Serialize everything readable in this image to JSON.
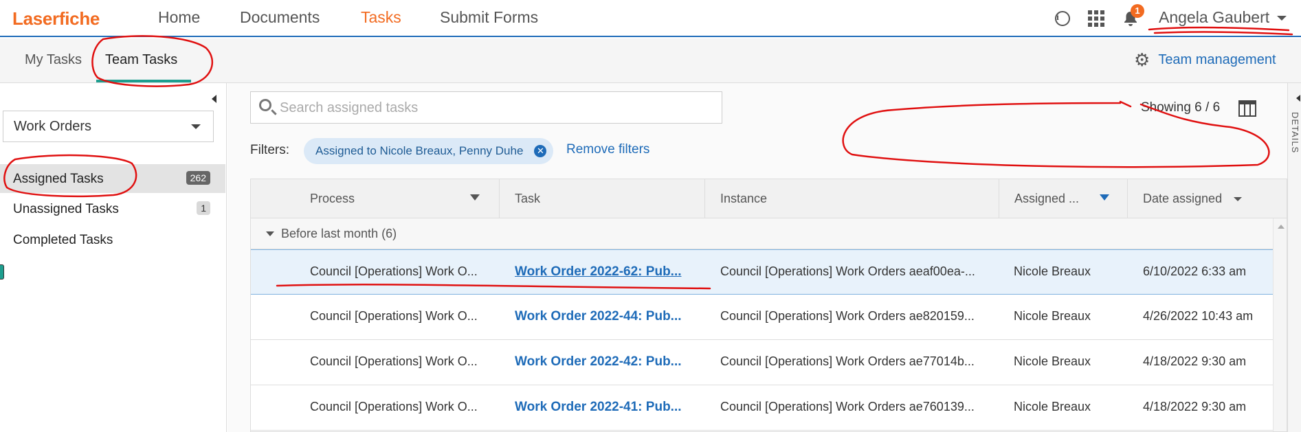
{
  "app": {
    "logo": "Laserfiche"
  },
  "nav": {
    "items": [
      {
        "label": "Home"
      },
      {
        "label": "Documents"
      },
      {
        "label": "Tasks"
      },
      {
        "label": "Submit Forms"
      }
    ],
    "active": "Tasks",
    "notification_count": "1",
    "user_name": "Angela Gaubert"
  },
  "subtabs": {
    "items": [
      {
        "label": "My Tasks"
      },
      {
        "label": "Team Tasks"
      }
    ],
    "active": "Team Tasks",
    "team_management": "Team management"
  },
  "sidebar": {
    "team_select": "Work Orders",
    "items": [
      {
        "label": "Assigned Tasks",
        "count": "262"
      },
      {
        "label": "Unassigned Tasks",
        "count": "1"
      },
      {
        "label": "Completed Tasks"
      }
    ]
  },
  "main": {
    "search_placeholder": "Search assigned tasks",
    "showing": "Showing 6 / 6",
    "filters_label": "Filters:",
    "filter_chip": "Assigned to Nicole Breaux, Penny Duhe",
    "remove_filters": "Remove filters"
  },
  "table": {
    "columns": [
      {
        "label": "Process"
      },
      {
        "label": "Task"
      },
      {
        "label": "Instance"
      },
      {
        "label": "Assigned ..."
      },
      {
        "label": "Date assigned"
      }
    ],
    "group_label": "Before last month (6)",
    "rows": [
      {
        "process": "Council [Operations] Work O...",
        "task": "Work Order 2022-62: Pub...",
        "instance": "Council [Operations] Work Orders aeaf00ea-...",
        "assigned": "Nicole Breaux",
        "date": "6/10/2022 6:33 am"
      },
      {
        "process": "Council [Operations] Work O...",
        "task": "Work Order 2022-44: Pub...",
        "instance": "Council [Operations] Work Orders ae820159...",
        "assigned": "Nicole Breaux",
        "date": "4/26/2022 10:43 am"
      },
      {
        "process": "Council [Operations] Work O...",
        "task": "Work Order 2022-42: Pub...",
        "instance": "Council [Operations] Work Orders ae77014b...",
        "assigned": "Nicole Breaux",
        "date": "4/18/2022 9:30 am"
      },
      {
        "process": "Council [Operations] Work O...",
        "task": "Work Order 2022-41: Pub...",
        "instance": "Council [Operations] Work Orders ae760139...",
        "assigned": "Nicole Breaux",
        "date": "4/18/2022 9:30 am"
      }
    ]
  },
  "details_panel": {
    "label": "DETAILS"
  },
  "colors": {
    "brand_orange": "#f26b21",
    "link_blue": "#1e6bb8",
    "accent_teal": "#1e9e8f",
    "annotation_red": "#e01010"
  }
}
